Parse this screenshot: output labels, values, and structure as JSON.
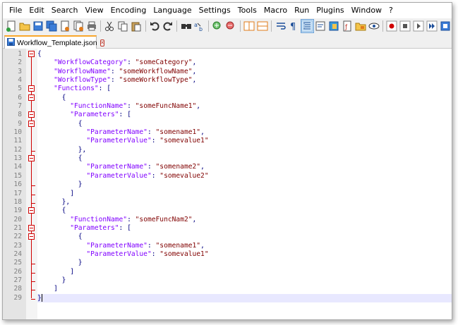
{
  "menu": [
    "File",
    "Edit",
    "Search",
    "View",
    "Encoding",
    "Language",
    "Settings",
    "Tools",
    "Macro",
    "Run",
    "Plugins",
    "Window",
    "?"
  ],
  "toolbar": {
    "icons": [
      "new-file-icon",
      "open-file-icon",
      "save-icon",
      "save-all-icon",
      "close-icon",
      "close-all-icon",
      "print-icon",
      "sep",
      "cut-icon",
      "copy-icon",
      "paste-icon",
      "sep",
      "undo-icon",
      "redo-icon",
      "sep",
      "find-icon",
      "replace-icon",
      "sep",
      "zoom-in-icon",
      "zoom-out-icon",
      "sep",
      "sync-vertical-icon",
      "sync-horizontal-icon",
      "sep",
      "word-wrap-icon",
      "show-all-chars-icon",
      "indent-guide-icon",
      "user-lang-icon",
      "doc-map-icon",
      "function-list-icon",
      "folder-workspace-icon",
      "monitor-icon",
      "sep",
      "record-macro-icon",
      "stop-record-icon",
      "play-macro-icon",
      "play-multiple-icon",
      "save-macro-icon"
    ],
    "active_icon": "indent-guide-icon"
  },
  "tab": {
    "label": "Workflow_Template.json"
  },
  "editor": {
    "current_line": 29,
    "lines": [
      {
        "n": "1",
        "indent": "",
        "parts": [
          [
            "b",
            "{"
          ]
        ]
      },
      {
        "n": "2",
        "indent": "    ",
        "parts": [
          [
            "k",
            "\"WorkflowCategory\""
          ],
          [
            "o",
            ": "
          ],
          [
            "s",
            "\"someCategory\""
          ],
          [
            "o",
            ","
          ]
        ]
      },
      {
        "n": "3",
        "indent": "    ",
        "parts": [
          [
            "k",
            "\"WorkflowName\""
          ],
          [
            "o",
            ": "
          ],
          [
            "s",
            "\"someWorkflowName\""
          ],
          [
            "o",
            ","
          ]
        ]
      },
      {
        "n": "4",
        "indent": "    ",
        "parts": [
          [
            "k",
            "\"WorkflowType\""
          ],
          [
            "o",
            ": "
          ],
          [
            "s",
            "\"someWorkflowType\""
          ],
          [
            "o",
            ","
          ]
        ]
      },
      {
        "n": "5",
        "indent": "    ",
        "parts": [
          [
            "k",
            "\"Functions\""
          ],
          [
            "o",
            ": ["
          ]
        ]
      },
      {
        "n": "6",
        "indent": "      ",
        "parts": [
          [
            "b",
            "{"
          ]
        ]
      },
      {
        "n": "7",
        "indent": "        ",
        "parts": [
          [
            "k",
            "\"FunctionName\""
          ],
          [
            "o",
            ": "
          ],
          [
            "s",
            "\"someFuncName1\""
          ],
          [
            "o",
            ","
          ]
        ]
      },
      {
        "n": "8",
        "indent": "        ",
        "parts": [
          [
            "k",
            "\"Parameters\""
          ],
          [
            "o",
            ": ["
          ]
        ]
      },
      {
        "n": "9",
        "indent": "          ",
        "parts": [
          [
            "b",
            "{"
          ]
        ]
      },
      {
        "n": "10",
        "indent": "            ",
        "parts": [
          [
            "k",
            "\"ParameterName\""
          ],
          [
            "o",
            ": "
          ],
          [
            "s",
            "\"somename1\""
          ],
          [
            "o",
            ","
          ]
        ]
      },
      {
        "n": "11",
        "indent": "            ",
        "parts": [
          [
            "k",
            "\"ParameterValue\""
          ],
          [
            "o",
            ": "
          ],
          [
            "s",
            "\"somevalue1\""
          ]
        ]
      },
      {
        "n": "12",
        "indent": "          ",
        "parts": [
          [
            "b",
            "},"
          ]
        ]
      },
      {
        "n": "13",
        "indent": "          ",
        "parts": [
          [
            "b",
            "{"
          ]
        ]
      },
      {
        "n": "14",
        "indent": "            ",
        "parts": [
          [
            "k",
            "\"ParameterName\""
          ],
          [
            "o",
            ": "
          ],
          [
            "s",
            "\"somename2\""
          ],
          [
            "o",
            ","
          ]
        ]
      },
      {
        "n": "15",
        "indent": "            ",
        "parts": [
          [
            "k",
            "\"ParameterValue\""
          ],
          [
            "o",
            ": "
          ],
          [
            "s",
            "\"somevalue2\""
          ]
        ]
      },
      {
        "n": "16",
        "indent": "          ",
        "parts": [
          [
            "b",
            "}"
          ]
        ]
      },
      {
        "n": "17",
        "indent": "        ",
        "parts": [
          [
            "o",
            "]"
          ]
        ]
      },
      {
        "n": "18",
        "indent": "      ",
        "parts": [
          [
            "b",
            "},"
          ]
        ]
      },
      {
        "n": "19",
        "indent": "      ",
        "parts": [
          [
            "b",
            "{"
          ]
        ]
      },
      {
        "n": "20",
        "indent": "        ",
        "parts": [
          [
            "k",
            "\"FunctionName\""
          ],
          [
            "o",
            ": "
          ],
          [
            "s",
            "\"someFuncNam2\""
          ],
          [
            "o",
            ","
          ]
        ]
      },
      {
        "n": "21",
        "indent": "        ",
        "parts": [
          [
            "k",
            "\"Parameters\""
          ],
          [
            "o",
            ": ["
          ]
        ]
      },
      {
        "n": "22",
        "indent": "          ",
        "parts": [
          [
            "b",
            "{"
          ]
        ]
      },
      {
        "n": "23",
        "indent": "            ",
        "parts": [
          [
            "k",
            "\"ParameterName\""
          ],
          [
            "o",
            ": "
          ],
          [
            "s",
            "\"somename1\""
          ],
          [
            "o",
            ","
          ]
        ]
      },
      {
        "n": "24",
        "indent": "            ",
        "parts": [
          [
            "k",
            "\"ParameterValue\""
          ],
          [
            "o",
            ": "
          ],
          [
            "s",
            "\"somevalue1\""
          ]
        ]
      },
      {
        "n": "25",
        "indent": "          ",
        "parts": [
          [
            "b",
            "}"
          ]
        ]
      },
      {
        "n": "26",
        "indent": "        ",
        "parts": [
          [
            "o",
            "]"
          ]
        ]
      },
      {
        "n": "27",
        "indent": "      ",
        "parts": [
          [
            "b",
            "}"
          ]
        ]
      },
      {
        "n": "28",
        "indent": "    ",
        "parts": [
          [
            "o",
            "]"
          ]
        ]
      },
      {
        "n": "29",
        "indent": "",
        "parts": [
          [
            "b",
            "}"
          ]
        ]
      }
    ],
    "fold_starts": [
      1,
      5,
      6,
      8,
      9,
      13,
      19,
      21,
      22
    ],
    "fold_ends": [
      12,
      16,
      17,
      18,
      25,
      26,
      27,
      28,
      29
    ]
  },
  "colors": {
    "key": "#8000ff",
    "string": "#800000",
    "operator": "#000080",
    "fold": "#d00000",
    "tab_accent": "#f9a72b"
  }
}
